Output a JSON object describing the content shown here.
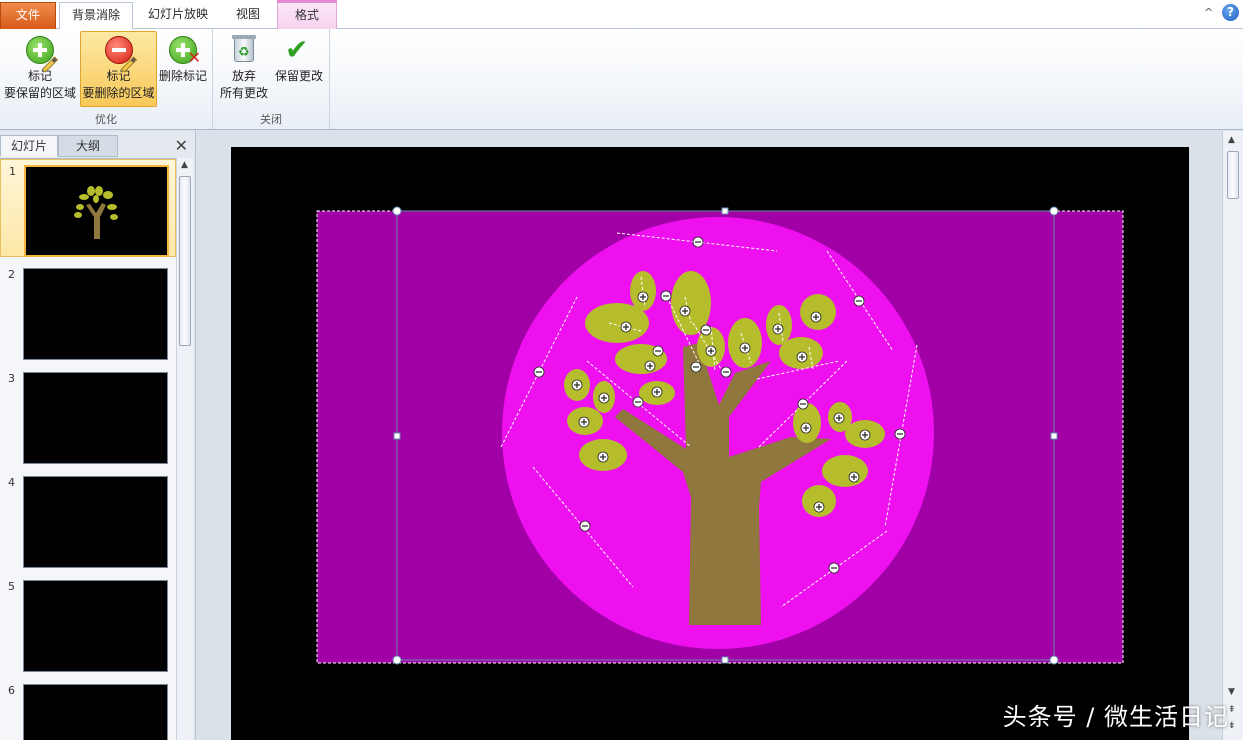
{
  "tabs": {
    "file": "文件",
    "background_removal": "背景消除",
    "slideshow": "幻灯片放映",
    "view": "视图",
    "format": "格式"
  },
  "ribbon": {
    "mark_keep_line1": "标记",
    "mark_keep_line2": "要保留的区域",
    "mark_remove_line1": "标记",
    "mark_remove_line2": "要删除的区域",
    "delete_mark": "删除标记",
    "discard_line1": "放弃",
    "discard_line2": "所有更改",
    "keep_changes": "保留更改",
    "group_refine": "优化",
    "group_close": "关闭"
  },
  "panel": {
    "tab_slides": "幻灯片",
    "tab_outline": "大纲",
    "slides": [
      {
        "num": "1",
        "selected": true
      },
      {
        "num": "2",
        "selected": false
      },
      {
        "num": "3",
        "selected": false
      },
      {
        "num": "4",
        "selected": false
      },
      {
        "num": "5",
        "selected": false
      },
      {
        "num": "6",
        "selected": false
      }
    ]
  },
  "colors": {
    "remove_overlay": "#a000a6",
    "circle": "#ee10ee",
    "trunk": "#8f773e",
    "leaf": "#b6bd2c",
    "accent_file_tab": "#e06a28"
  },
  "watermark": "头条号 / 微生活日记"
}
